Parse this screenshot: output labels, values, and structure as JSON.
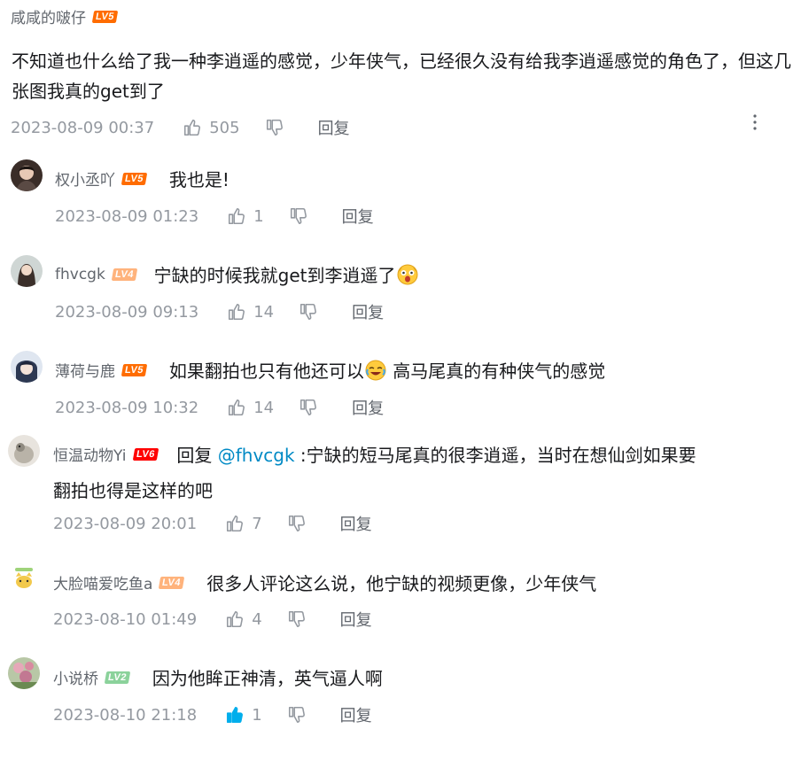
{
  "root": {
    "username": "咸咸的啵仔",
    "level": "LV5",
    "text": "不知道也什么给了我一种李逍遥的感觉，少年侠气，已经很久没有给我李逍遥感觉的角色了，但这几张图我真的get到了",
    "time": "2023-08-09 00:37",
    "likes": "505",
    "reply_label": "回复"
  },
  "replies": [
    {
      "username": "权小丞吖",
      "level": "LV5",
      "text": "我也是!",
      "time": "2023-08-09 01:23",
      "likes": "1",
      "reply_label": "回复"
    },
    {
      "username": "fhvcgk",
      "level": "LV4",
      "text": "宁缺的时候我就get到李逍遥了",
      "time": "2023-08-09 09:13",
      "likes": "14",
      "reply_label": "回复",
      "emoji": "excited-face-emoji"
    },
    {
      "username": "薄荷与鹿",
      "level": "LV5",
      "text_before": "如果翻拍也只有他还可以",
      "text_after": " 高马尾真的有种侠气的感觉",
      "time": "2023-08-09 10:32",
      "likes": "14",
      "reply_label": "回复",
      "emoji": "crying-laughing-emoji"
    },
    {
      "username": "恒温动物Yi",
      "level": "LV6",
      "reply_prefix": "回复",
      "mention": "@fhvcgk",
      "text_line1": ":宁缺的短马尾真的很李逍遥，当时在想仙剑如果要",
      "text_line2": "翻拍也得是这样的吧",
      "time": "2023-08-09 20:01",
      "likes": "7",
      "reply_label": "回复"
    },
    {
      "username": "大脸喵爱吃鱼a",
      "level": "LV4",
      "text": "很多人评论这么说，他宁缺的视频更像，少年侠气",
      "time": "2023-08-10 01:49",
      "likes": "4",
      "reply_label": "回复"
    },
    {
      "username": "小说桥",
      "level": "LV2",
      "text": "因为他眸正神清，英气逼人啊",
      "time": "2023-08-10 21:18",
      "likes": "1",
      "reply_label": "回复",
      "liked": true
    }
  ],
  "colors": {
    "meta": "#9499a0",
    "mention": "#008ac5",
    "liked": "#00aeec"
  },
  "icons": {
    "like": "thumbs-up-icon",
    "dislike": "thumbs-down-icon",
    "more": "more-vertical-icon"
  }
}
